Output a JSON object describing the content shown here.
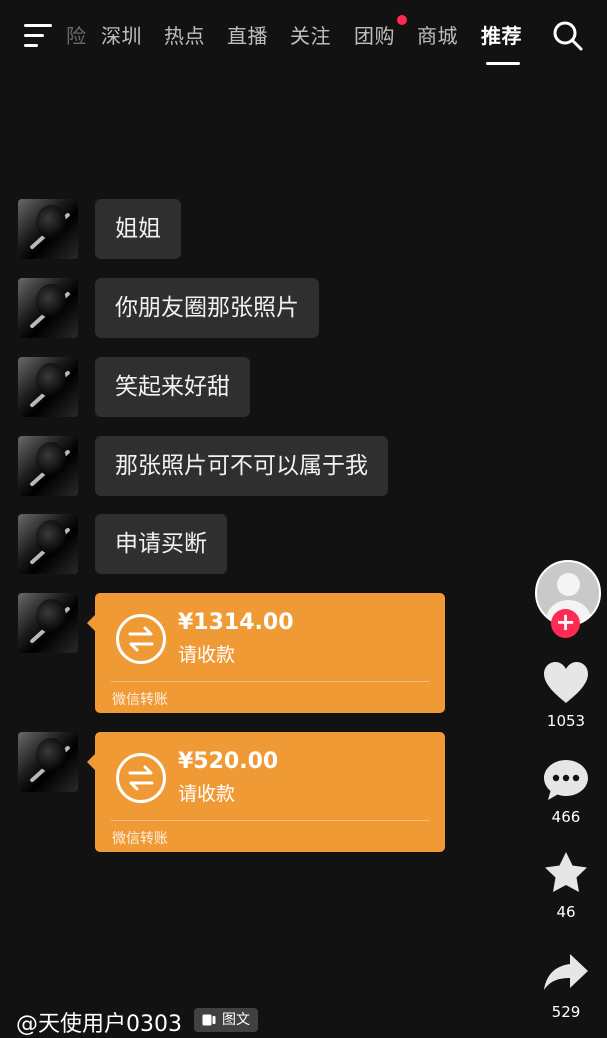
{
  "nav": {
    "tabs": [
      {
        "label": "险"
      },
      {
        "label": "深圳"
      },
      {
        "label": "热点"
      },
      {
        "label": "直播"
      },
      {
        "label": "关注"
      },
      {
        "label": "团购",
        "has_dot": true
      },
      {
        "label": "商城"
      },
      {
        "label": "推荐",
        "active": true
      }
    ],
    "icons": {
      "menu": "hamburger-menu-icon",
      "search": "search-icon"
    }
  },
  "chat": {
    "messages": [
      {
        "type": "text",
        "text": "姐姐"
      },
      {
        "type": "text",
        "text": "你朋友圈那张照片"
      },
      {
        "type": "text",
        "text": "笑起来好甜"
      },
      {
        "type": "text",
        "text": "那张照片可不可以属于我"
      },
      {
        "type": "text",
        "text": "申请买断"
      },
      {
        "type": "transfer",
        "amount": "¥1314.00",
        "status": "请收款",
        "footer": "微信转账"
      },
      {
        "type": "transfer",
        "amount": "¥520.00",
        "status": "请收款",
        "footer": "微信转账"
      }
    ],
    "colors": {
      "bubble": "#2f2f2f",
      "transfer": "#f09a36"
    }
  },
  "rail": {
    "follow_label": "+",
    "likes": "1053",
    "comments": "466",
    "favorites": "46",
    "shares": "529",
    "colors": {
      "follow": "#fe2c55"
    }
  },
  "post": {
    "username": "@天使用户0303",
    "badge": "图文"
  }
}
